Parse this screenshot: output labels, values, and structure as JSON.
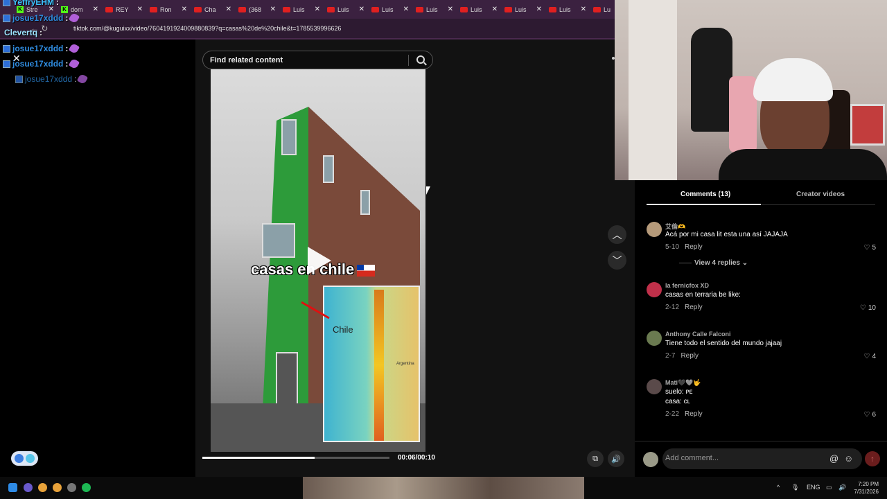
{
  "browser": {
    "tabs": [
      {
        "label": "Stre",
        "icon": "kick-icon"
      },
      {
        "label": "dom",
        "icon": "kick-icon"
      },
      {
        "label": "REY",
        "icon": "youtube-icon"
      },
      {
        "label": "Ron",
        "icon": "youtube-icon"
      },
      {
        "label": "Cha",
        "icon": "youtube-icon"
      },
      {
        "label": "(368",
        "icon": "youtube-icon"
      },
      {
        "label": "Luis",
        "icon": "youtube-icon"
      },
      {
        "label": "Luis",
        "icon": "youtube-icon"
      },
      {
        "label": "Luis",
        "icon": "youtube-icon"
      },
      {
        "label": "Luis",
        "icon": "youtube-icon"
      },
      {
        "label": "Luis",
        "icon": "youtube-icon"
      },
      {
        "label": "Luis",
        "icon": "youtube-icon"
      },
      {
        "label": "Luis",
        "icon": "youtube-icon"
      },
      {
        "label": "Lu",
        "icon": "youtube-icon"
      }
    ],
    "url": "tiktok.com/@kuguixx/video/7604191924009880839?q=casas%20de%20chile&t=1785539996626"
  },
  "chat": {
    "messages": [
      {
        "user": "YeffryEHM",
        "sep": ":",
        "color": "#3cc2ff"
      },
      {
        "user": "josue17xddd",
        "sep": ":",
        "color": "#2f8ce0"
      },
      {
        "user": "Clevertq",
        "sep": ":",
        "color": "#9be3ff"
      },
      {
        "user": "josue17xddd",
        "sep": ":",
        "color": "#2f8ce0"
      },
      {
        "user": "josue17xddd",
        "sep": ":",
        "color": "#2f8ce0"
      },
      {
        "user": "josue17xddd",
        "sep": ":",
        "color": "#2f8ce0"
      }
    ]
  },
  "search": {
    "placeholder": "Find related content"
  },
  "video": {
    "caption": "casas en chile",
    "map_label": "Chile",
    "map_sublabel": "Argentina",
    "time": "00:06/00:10",
    "progress": 0.6
  },
  "comments_panel": {
    "tab_active": "Comments (13)",
    "tab_other": "Creator videos",
    "comments": [
      {
        "user": "艾倫🫶",
        "text": "Acá por mi casa lit esta una así JAJAJA",
        "date": "5-10",
        "reply": "Reply",
        "likes": "5",
        "avatar_color": "#b59a7a",
        "replies": "View 4 replies"
      },
      {
        "user": "la fernicfox XD",
        "text": "casas en terraria be like:",
        "date": "2-12",
        "reply": "Reply",
        "likes": "10",
        "avatar_color": "#c0304a"
      },
      {
        "user": "Anthony Calle Falconi",
        "text": "Tiene todo el sentido del mundo jajaaj",
        "date": "2-7",
        "reply": "Reply",
        "likes": "4",
        "avatar_color": "#6a7a50"
      },
      {
        "user": "Mati🖤🩶🤟",
        "text": "suelo: ᴘᴇ",
        "text2": "casa: ᴄʟ",
        "date": "2-22",
        "reply": "Reply",
        "likes": "6",
        "avatar_color": "#5a4a4a"
      }
    ],
    "add_comment_placeholder": "Add comment...",
    "at_symbol": "@",
    "emoji_symbol": "☺",
    "send_symbol": "↑"
  },
  "taskbar": {
    "language": "ENG",
    "time": "7:20 PM",
    "date": "7/31/2026"
  },
  "colors": {
    "accent": "#fe2c55",
    "page_bg": "#000000",
    "tab_bar": "#3b2140"
  }
}
